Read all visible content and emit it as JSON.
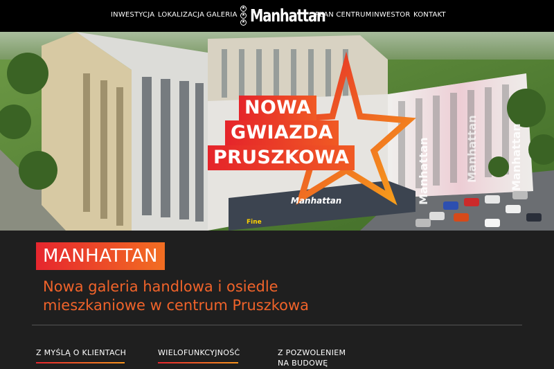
{
  "nav": {
    "items": [
      "INWESTYCJA",
      "LOKALIZACJA",
      "GALERIA",
      "PLAN CENTRUM",
      "INWESTOR",
      "KONTAKT"
    ],
    "logo_text": "Manhattan"
  },
  "hero": {
    "title_lines": [
      "NOWA",
      "GWIAZDA",
      "PRUSZKOWA"
    ],
    "building_sign": "Manhattan",
    "store_sign": "Fine",
    "facade_text": [
      "Manhattan",
      "Manhattan",
      "Manhattan"
    ]
  },
  "content": {
    "tag": "MANHATTAN",
    "subtitle_line1": "Nowa galeria handlowa i osiedle",
    "subtitle_line2": "mieszkaniowe w centrum Pruszkowa",
    "features": [
      "Z MYŚLĄ O KLIENTACH",
      "WIELOFUNKCYJNOŚĆ",
      "Z POZWOLENIEM NA BUDOWĘ"
    ]
  },
  "colors": {
    "accent_red": "#e6262e",
    "accent_orange": "#f26e22",
    "background": "#1f1f1f",
    "nav_bg": "#000000"
  }
}
